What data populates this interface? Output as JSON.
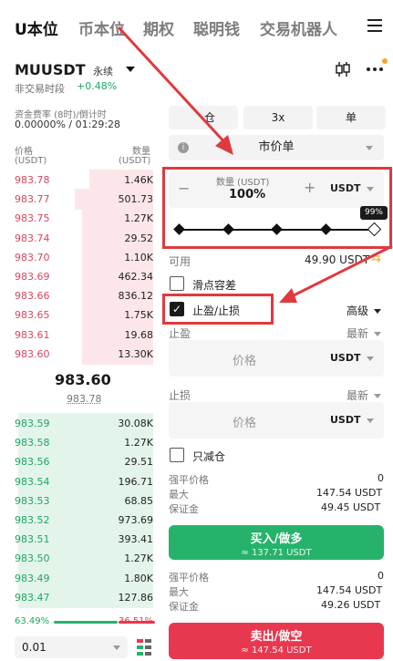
{
  "tabs": [
    "U本位",
    "币本位",
    "期权",
    "聪明钱",
    "交易机器人"
  ],
  "symbol": "MUUSDT",
  "perpetual": "永续",
  "session": "非交易时段",
  "change": "+0.48%",
  "funding": {
    "label": "资金费率 (8时)/倒计时",
    "value": "0.00000% / 01:29:28"
  },
  "orderbook": {
    "price_header": "价格",
    "price_unit": "(USDT)",
    "qty_header": "数量",
    "qty_unit": "(USDT)",
    "asks": [
      {
        "p": "983.78",
        "q": "1.46K",
        "depth": 0.45
      },
      {
        "p": "983.77",
        "q": "501.73",
        "depth": 0.55
      },
      {
        "p": "983.75",
        "q": "1.27K",
        "depth": 0.5
      },
      {
        "p": "983.74",
        "q": "29.52",
        "depth": 0.5
      },
      {
        "p": "983.70",
        "q": "1.10K",
        "depth": 0.5
      },
      {
        "p": "983.69",
        "q": "462.34",
        "depth": 0.5
      },
      {
        "p": "983.66",
        "q": "836.12",
        "depth": 0.5
      },
      {
        "p": "983.65",
        "q": "1.75K",
        "depth": 0.5
      },
      {
        "p": "983.61",
        "q": "19.68",
        "depth": 0.5
      },
      {
        "p": "983.60",
        "q": "13.30K",
        "depth": 0.5
      }
    ],
    "last_price": "983.60",
    "mark_price": "983.78",
    "bids": [
      {
        "p": "983.59",
        "q": "30.08K",
        "depth": 0.95
      },
      {
        "p": "983.58",
        "q": "1.27K",
        "depth": 0.95
      },
      {
        "p": "983.56",
        "q": "29.51",
        "depth": 0.95
      },
      {
        "p": "983.54",
        "q": "196.71",
        "depth": 0.95
      },
      {
        "p": "983.53",
        "q": "68.85",
        "depth": 0.95
      },
      {
        "p": "983.52",
        "q": "973.69",
        "depth": 0.95
      },
      {
        "p": "983.51",
        "q": "393.41",
        "depth": 0.95
      },
      {
        "p": "983.50",
        "q": "1.27K",
        "depth": 0.95
      },
      {
        "p": "983.49",
        "q": "1.80K",
        "depth": 0.95
      },
      {
        "p": "983.47",
        "q": "127.86",
        "depth": 0.95
      }
    ],
    "buy_ratio": "63.49%",
    "sell_ratio": "36.51%",
    "buy_fraction": 0.6349,
    "precision": "0.01"
  },
  "order": {
    "margin_mode": "逐仓",
    "margin_mode_visible": "仓",
    "leverage": "3x",
    "position_mode": "单",
    "order_type": "市价单",
    "qty_label": "数量 (USDT)",
    "qty_value": "100%",
    "qty_unit": "USDT",
    "slider_badge": "99%",
    "slider_fraction": 0.99,
    "available_label": "可用",
    "available_value": "49.90 USDT",
    "slippage": "滑点容差",
    "tpsl": "止盈/止损",
    "advanced": "高级",
    "tp_label": "止盈",
    "tp_mode": "最新",
    "tp_placeholder": "价格",
    "tp_unit": "USDT",
    "sl_label": "止损",
    "sl_mode": "最新",
    "sl_placeholder": "价格",
    "sl_unit": "USDT",
    "reduce_only": "只减仓",
    "buy_info": {
      "liq_label": "强平价格",
      "liq": "0",
      "max_label": "最大",
      "max": "147.54 USDT",
      "margin_label": "保证金",
      "margin": "49.45 USDT"
    },
    "buy_button": "买入/做多",
    "buy_sub": "≈ 137.71 USDT",
    "sell_info": {
      "liq_label": "强平价格",
      "liq": "0",
      "max_label": "最大",
      "max": "147.54 USDT",
      "margin_label": "保证金",
      "margin": "49.26 USDT"
    },
    "sell_button": "卖出/做空",
    "sell_sub": "≈ 147.54 USDT"
  },
  "colors": {
    "buy": "#27b26c",
    "sell": "#e8384f",
    "highlight": "#e0393e"
  }
}
